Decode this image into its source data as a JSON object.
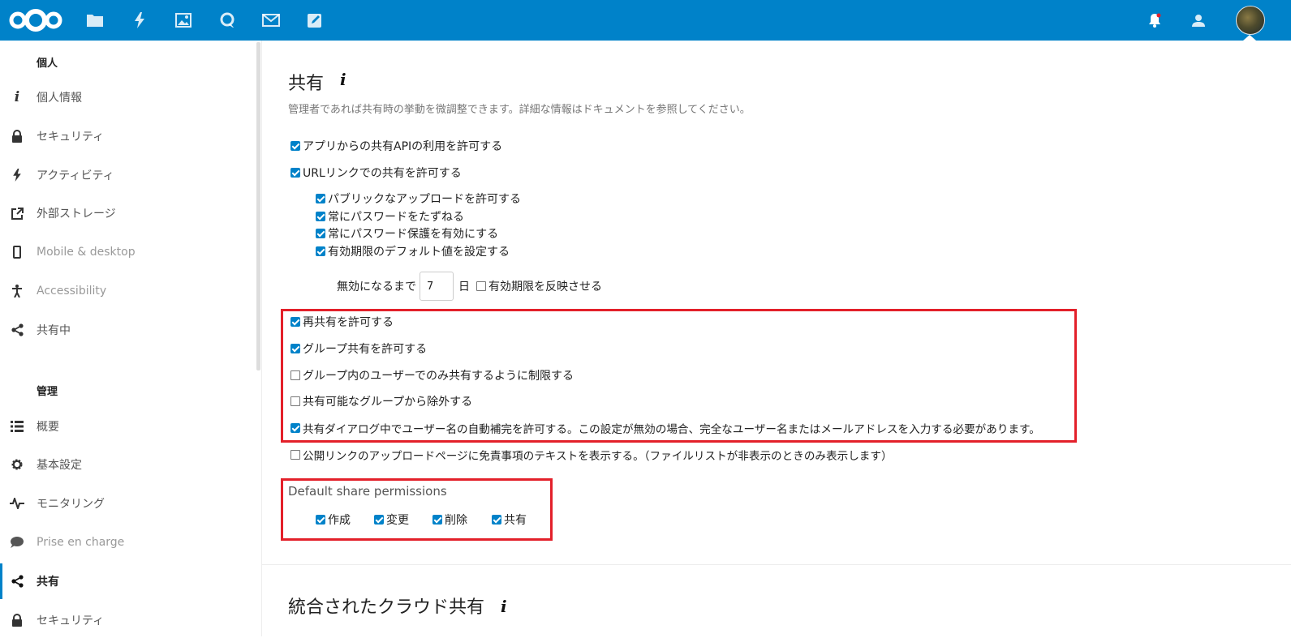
{
  "topbar": {
    "apps": [
      {
        "icon": "nextcloud-logo-icon"
      },
      {
        "icon": "files-folder-icon"
      },
      {
        "icon": "activity-bolt-icon"
      },
      {
        "icon": "photos-image-icon"
      },
      {
        "icon": "talk-chat-icon"
      },
      {
        "icon": "mail-envelope-icon"
      },
      {
        "icon": "notes-edit-icon"
      }
    ],
    "right_icons": [
      "notifications-bell-icon",
      "contacts-icon",
      "user-avatar"
    ],
    "colors": {
      "bar": "#0082c9",
      "accent": "#e3202a"
    }
  },
  "sidebar": {
    "personal_heading": "個人",
    "personal_items": [
      {
        "label": "個人情報",
        "icon": "info-icon"
      },
      {
        "label": "セキュリティ",
        "icon": "lock-icon"
      },
      {
        "label": "アクティビティ",
        "icon": "activity-bolt-icon"
      },
      {
        "label": "外部ストレージ",
        "icon": "external-link-icon"
      },
      {
        "label": "Mobile & desktop",
        "icon": "phone-icon"
      },
      {
        "label": "Accessibility",
        "icon": "accessibility-icon"
      },
      {
        "label": "共有中",
        "icon": "share-icon"
      }
    ],
    "admin_heading": "管理",
    "admin_items": [
      {
        "label": "概要",
        "icon": "overview-list-icon"
      },
      {
        "label": "基本設定",
        "icon": "gear-icon"
      },
      {
        "label": "モニタリング",
        "icon": "monitoring-pulse-icon"
      },
      {
        "label": "Prise en charge",
        "icon": "support-bubble-icon"
      },
      {
        "label": "共有",
        "icon": "share-icon",
        "active": true
      },
      {
        "label": "セキュリティ",
        "icon": "lock-icon"
      }
    ]
  },
  "sharing": {
    "title": "共有",
    "info_glyph": "i",
    "description": "管理者であれば共有時の挙動を微調整できます。詳細な情報はドキュメントを参照してください。",
    "allow_api": {
      "label": "アプリからの共有APIの利用を許可する",
      "checked": true
    },
    "allow_links": {
      "label": "URLリンクでの共有を許可する",
      "checked": true
    },
    "link_sub": [
      {
        "label": "パブリックなアップロードを許可する",
        "checked": true
      },
      {
        "label": "常にパスワードをたずねる",
        "checked": true
      },
      {
        "label": "常にパスワード保護を有効にする",
        "checked": true
      },
      {
        "label": "有効期限のデフォルト値を設定する",
        "checked": true
      }
    ],
    "expire_prefix": "無効になるまで",
    "expire_days": "7",
    "expire_unit": "日",
    "enforce_expire": {
      "label": "有効期限を反映させる",
      "checked": false
    },
    "boxed_options": [
      {
        "label": "再共有を許可する",
        "checked": true
      },
      {
        "label": "グループ共有を許可する",
        "checked": true
      },
      {
        "label": "グループ内のユーザーでのみ共有するように制限する",
        "checked": false
      },
      {
        "label": "共有可能なグループから除外する",
        "checked": false
      },
      {
        "label": "共有ダイアログ中でユーザー名の自動補完を許可する。この設定が無効の場合、完全なユーザー名またはメールアドレスを入力する必要があります。",
        "checked": true
      }
    ],
    "disclaimer": {
      "label": "公開リンクのアップロードページに免責事項のテキストを表示する。（ファイルリストが非表示のときのみ表示します）",
      "checked": false
    },
    "permissions_title": "Default share permissions",
    "permissions": [
      {
        "label": "作成",
        "checked": true
      },
      {
        "label": "変更",
        "checked": true
      },
      {
        "label": "削除",
        "checked": true
      },
      {
        "label": "共有",
        "checked": true
      }
    ]
  },
  "federated": {
    "title": "統合されたクラウド共有",
    "info_glyph": "i"
  }
}
